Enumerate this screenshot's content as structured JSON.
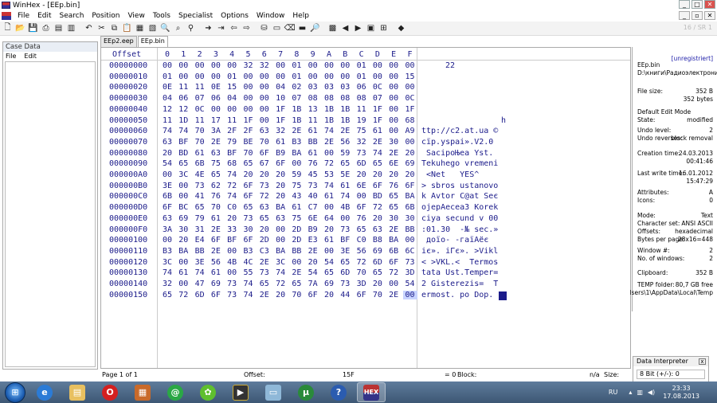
{
  "window": {
    "title": "WinHex - [EEp.bin]",
    "min": "_",
    "max": "□",
    "close": "✕"
  },
  "menu": [
    "File",
    "Edit",
    "Search",
    "Position",
    "View",
    "Tools",
    "Specialist",
    "Options",
    "Window",
    "Help"
  ],
  "mdi_buttons": {
    "min": "_",
    "restore": "▫",
    "close": "✕"
  },
  "toolbar_right": "16 / SR 1",
  "case_pane": {
    "title": "Case Data",
    "menu": [
      "File",
      "Edit"
    ]
  },
  "tabs": [
    "EEp2.eep",
    "EEp.bin"
  ],
  "hex": {
    "offset_header": "Offset",
    "column_headers": [
      "0",
      "1",
      "2",
      "3",
      "4",
      "5",
      "6",
      "7",
      "8",
      "9",
      "A",
      "B",
      "C",
      "D",
      "E",
      "F"
    ],
    "rows": [
      {
        "offset": "00000000",
        "bytes": [
          "00",
          "00",
          "00",
          "00",
          "00",
          "32",
          "32",
          "00",
          "01",
          "00",
          "00",
          "00",
          "01",
          "00",
          "00",
          "00"
        ],
        "text": "22",
        "align": "center"
      },
      {
        "offset": "00000010",
        "bytes": [
          "01",
          "00",
          "00",
          "00",
          "01",
          "00",
          "00",
          "00",
          "01",
          "00",
          "00",
          "00",
          "01",
          "00",
          "00",
          "15"
        ],
        "text": "",
        "align": "left"
      },
      {
        "offset": "00000020",
        "bytes": [
          "0E",
          "11",
          "11",
          "0E",
          "15",
          "00",
          "00",
          "04",
          "02",
          "03",
          "03",
          "03",
          "06",
          "0C",
          "00",
          "00"
        ],
        "text": "",
        "align": "left"
      },
      {
        "offset": "00000030",
        "bytes": [
          "04",
          "06",
          "07",
          "06",
          "04",
          "00",
          "00",
          "10",
          "07",
          "08",
          "08",
          "08",
          "08",
          "07",
          "00",
          "0C"
        ],
        "text": "",
        "align": "left"
      },
      {
        "offset": "00000040",
        "bytes": [
          "12",
          "12",
          "0C",
          "00",
          "00",
          "00",
          "00",
          "1F",
          "1B",
          "13",
          "1B",
          "1B",
          "11",
          "1F",
          "00",
          "1F"
        ],
        "text": "",
        "align": "left"
      },
      {
        "offset": "00000050",
        "bytes": [
          "11",
          "1D",
          "11",
          "17",
          "11",
          "1F",
          "00",
          "1F",
          "1B",
          "11",
          "1B",
          "1B",
          "19",
          "1F",
          "00",
          "68"
        ],
        "text": "h",
        "align": "right"
      },
      {
        "offset": "00000060",
        "bytes": [
          "74",
          "74",
          "70",
          "3A",
          "2F",
          "2F",
          "63",
          "32",
          "2E",
          "61",
          "74",
          "2E",
          "75",
          "61",
          "00",
          "A9"
        ],
        "text": "ttp://c2.at.ua ©",
        "align": "left"
      },
      {
        "offset": "00000070",
        "bytes": [
          "63",
          "BF",
          "70",
          "2E",
          "79",
          "BE",
          "70",
          "61",
          "B3",
          "BB",
          "2E",
          "56",
          "32",
          "2E",
          "30",
          "00"
        ],
        "text": "cїp.yѕpaі».V2.0",
        "align": "left"
      },
      {
        "offset": "00000080",
        "bytes": [
          "20",
          "BD",
          "61",
          "63",
          "BF",
          "70",
          "6F",
          "B9",
          "BA",
          "61",
          "00",
          "59",
          "73",
          "74",
          "2E",
          "20"
        ],
        "text": " SacipoЊea Yst. ",
        "align": "left"
      },
      {
        "offset": "00000090",
        "bytes": [
          "54",
          "65",
          "6B",
          "75",
          "68",
          "65",
          "67",
          "6F",
          "00",
          "76",
          "72",
          "65",
          "6D",
          "65",
          "6E",
          "69"
        ],
        "text": "Tekuhego vremeni",
        "align": "left"
      },
      {
        "offset": "000000A0",
        "bytes": [
          "00",
          "3C",
          "4E",
          "65",
          "74",
          "20",
          "20",
          "20",
          "59",
          "45",
          "53",
          "5E",
          "20",
          "20",
          "20",
          "20"
        ],
        "text": " <Net   YES^    ",
        "align": "left"
      },
      {
        "offset": "000000B0",
        "bytes": [
          "3E",
          "00",
          "73",
          "62",
          "72",
          "6F",
          "73",
          "20",
          "75",
          "73",
          "74",
          "61",
          "6E",
          "6F",
          "76",
          "6F"
        ],
        "text": "> sbros ustanovo",
        "align": "left"
      },
      {
        "offset": "000000C0",
        "bytes": [
          "6B",
          "00",
          "41",
          "76",
          "74",
          "6F",
          "72",
          "20",
          "43",
          "40",
          "61",
          "74",
          "00",
          "BD",
          "65",
          "BA"
        ],
        "text": "k Avtor C@at Seє",
        "align": "left"
      },
      {
        "offset": "000000D0",
        "bytes": [
          "6F",
          "BC",
          "65",
          "70",
          "C0",
          "65",
          "63",
          "BA",
          "61",
          "C7",
          "00",
          "4B",
          "6F",
          "72",
          "65",
          "6B"
        ],
        "text": "ojepАeceaЗ Korek",
        "align": "left"
      },
      {
        "offset": "000000E0",
        "bytes": [
          "63",
          "69",
          "79",
          "61",
          "20",
          "73",
          "65",
          "63",
          "75",
          "6E",
          "64",
          "00",
          "76",
          "20",
          "30",
          "30"
        ],
        "text": "ciya secund v 00",
        "align": "left"
      },
      {
        "offset": "000000F0",
        "bytes": [
          "3A",
          "30",
          "31",
          "2E",
          "33",
          "30",
          "20",
          "00",
          "2D",
          "B9",
          "20",
          "73",
          "65",
          "63",
          "2E",
          "BB"
        ],
        "text": ":01.30  -№ sec.»",
        "align": "left"
      },
      {
        "offset": "00000100",
        "bytes": [
          "00",
          "20",
          "E4",
          "6F",
          "BF",
          "6F",
          "2D",
          "00",
          "2D",
          "E3",
          "61",
          "BF",
          "C0",
          "B8",
          "BA",
          "00"
        ],
        "text": " доїо- -гаїАёє ",
        "align": "left"
      },
      {
        "offset": "00000110",
        "bytes": [
          "B3",
          "BA",
          "BB",
          "2E",
          "00",
          "B3",
          "C3",
          "BA",
          "BB",
          "2E",
          "00",
          "3E",
          "56",
          "69",
          "6B",
          "6C"
        ],
        "text": "іє». іГє». >Vikl",
        "align": "left"
      },
      {
        "offset": "00000120",
        "bytes": [
          "3C",
          "00",
          "3E",
          "56",
          "4B",
          "4C",
          "2E",
          "3C",
          "00",
          "20",
          "54",
          "65",
          "72",
          "6D",
          "6F",
          "73"
        ],
        "text": "< >VKL.<  Termos",
        "align": "left"
      },
      {
        "offset": "00000130",
        "bytes": [
          "74",
          "61",
          "74",
          "61",
          "00",
          "55",
          "73",
          "74",
          "2E",
          "54",
          "65",
          "6D",
          "70",
          "65",
          "72",
          "3D"
        ],
        "text": "tata Ust.Temper=",
        "align": "left"
      },
      {
        "offset": "00000140",
        "bytes": [
          "32",
          "00",
          "47",
          "69",
          "73",
          "74",
          "65",
          "72",
          "65",
          "7A",
          "69",
          "73",
          "3D",
          "20",
          "00",
          "54"
        ],
        "text": "2 Gisterezis=  T",
        "align": "left"
      },
      {
        "offset": "00000150",
        "bytes": [
          "65",
          "72",
          "6D",
          "6F",
          "73",
          "74",
          "2E",
          "20",
          "70",
          "6F",
          "20",
          "44",
          "6F",
          "70",
          "2E",
          "00"
        ],
        "text": "ermost. po Dop.",
        "align": "left"
      }
    ]
  },
  "status": {
    "page": "Page 1 of 1",
    "offset_label": "Offset:",
    "offset_value": "15F",
    "sel": "= 0",
    "block_label": "Block:",
    "na": "n/a",
    "size_label": "Size:"
  },
  "info": {
    "unreg": "[unregistriert]",
    "filename": "EEp.bin",
    "path": "D:\\книги\\Радиоэлектроника",
    "rows": [
      {
        "label": "File size:",
        "value": "352 B"
      },
      {
        "label": "",
        "value": "352 bytes"
      },
      {
        "label": "Default Edit Mode",
        "value": ""
      },
      {
        "label": "State:",
        "value": "modified"
      },
      {
        "label": "Undo level:",
        "value": "2"
      },
      {
        "label": "Undo reverses:",
        "value": "block removal"
      },
      {
        "label": "Creation time:",
        "value": "24.03.2013"
      },
      {
        "label": "",
        "value": "00:41:46"
      },
      {
        "label": "Last write time:",
        "value": "16.01.2012"
      },
      {
        "label": "",
        "value": "15:47:29"
      },
      {
        "label": "Attributes:",
        "value": "A"
      },
      {
        "label": "Icons:",
        "value": "0"
      },
      {
        "label": "Mode:",
        "value": "Text"
      },
      {
        "label": "Character set:",
        "value": "ANSI ASCII"
      },
      {
        "label": "Offsets:",
        "value": "hexadecimal"
      },
      {
        "label": "Bytes per page:",
        "value": "28x16=448"
      },
      {
        "label": "Window #:",
        "value": "2"
      },
      {
        "label": "No. of windows:",
        "value": "2"
      },
      {
        "label": "Clipboard:",
        "value": "352 B"
      },
      {
        "label": "TEMP folder:",
        "value": "80,7 GB free"
      },
      {
        "label": "",
        "value": "lsers\\1\\AppData\\Local\\Temp"
      }
    ]
  },
  "interpreter": {
    "title": "Data Interpreter",
    "close": "x",
    "row": "8 Bit (+/-): 0"
  },
  "taskbar": {
    "lang": "RU",
    "time": "23:33",
    "date": "17.08.2013",
    "apps": [
      "ie",
      "explorer",
      "opera",
      "archive",
      "qip",
      "icq",
      "video",
      "folder",
      "utorrent",
      "help",
      "winhex"
    ]
  }
}
